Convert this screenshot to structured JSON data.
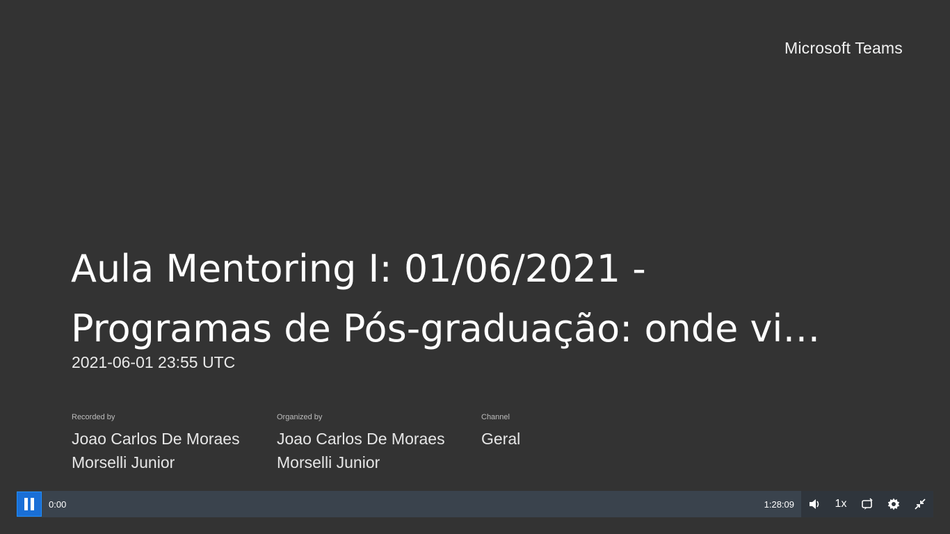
{
  "brand": "Microsoft Teams",
  "recording": {
    "title_line1": "Aula Mentoring I: 01/06/2021 -",
    "title_line2": "Programas de Pós-graduação: onde vi…",
    "date": "2021-06-01 23:55 UTC"
  },
  "meta": [
    {
      "label": "Recorded by",
      "value": "Joao Carlos De Moraes Morselli Junior"
    },
    {
      "label": "Organized by",
      "value": "Joao Carlos De Moraes Morselli Junior"
    },
    {
      "label": "Channel",
      "value": "Geral"
    }
  ],
  "player": {
    "current_time": "0:00",
    "total_time": "1:28:09",
    "speed": "1x",
    "progress": 0.0,
    "icons": {
      "play": "pause-icon",
      "volume": "volume-icon",
      "captions": "captions-icon",
      "settings": "gear-icon",
      "minimize": "exit-fullscreen-icon"
    }
  },
  "colors": {
    "background": "#333333",
    "accent": "#1a6fd6",
    "controls": "#3a434d"
  }
}
